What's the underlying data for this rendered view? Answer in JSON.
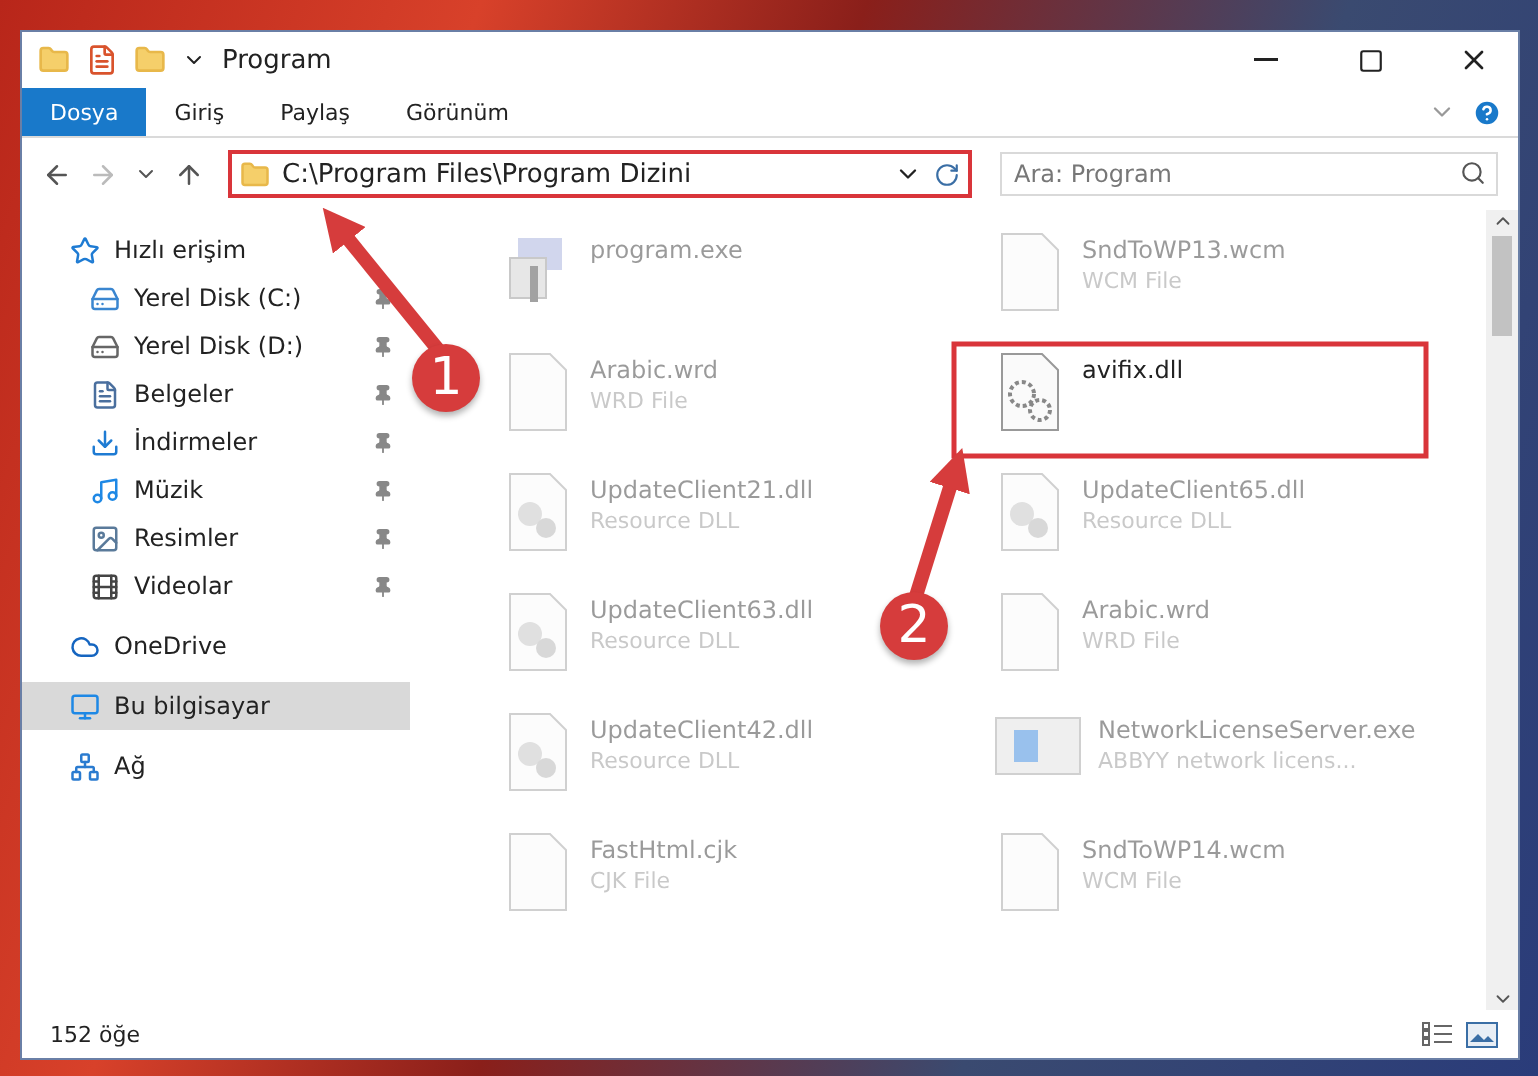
{
  "window": {
    "title": "Program"
  },
  "ribbon_tabs": [
    {
      "label": "Dosya",
      "selected": true
    },
    {
      "label": "Giriş",
      "selected": false
    },
    {
      "label": "Paylaş",
      "selected": false
    },
    {
      "label": "Görünüm",
      "selected": false
    }
  ],
  "address_bar": {
    "path": "C:\\Program Files\\Program Dizini",
    "highlighted": true
  },
  "search": {
    "placeholder": "Ara: Program"
  },
  "sidebar": {
    "items": [
      {
        "kind": "star",
        "label": "Hızlı erişim",
        "selected": false,
        "children": [
          {
            "kind": "drive-c",
            "label": "Yerel Disk (C:)",
            "pinned": true,
            "selected": false
          },
          {
            "kind": "drive",
            "label": "Yerel Disk (D:)",
            "pinned": true,
            "selected": false
          },
          {
            "kind": "docs",
            "label": "Belgeler",
            "pinned": true,
            "selected": false
          },
          {
            "kind": "download",
            "label": "İndirmeler",
            "pinned": true,
            "selected": false
          },
          {
            "kind": "music",
            "label": "Müzik",
            "pinned": true,
            "selected": false
          },
          {
            "kind": "pictures",
            "label": "Resimler",
            "pinned": true,
            "selected": false
          },
          {
            "kind": "video",
            "label": "Videolar",
            "pinned": true,
            "selected": false
          }
        ]
      },
      {
        "kind": "cloud",
        "label": "OneDrive",
        "selected": false
      },
      {
        "kind": "pc",
        "label": "Bu bilgisayar",
        "selected": true
      },
      {
        "kind": "network",
        "label": "Ağ",
        "selected": false
      }
    ]
  },
  "files": [
    {
      "kind": "app",
      "name": "program.exe",
      "dimmed": true,
      "highlighted": false
    },
    {
      "kind": "blank",
      "name": "SndToWP13.wcm",
      "type": "WCM File",
      "dimmed": true,
      "highlighted": false
    },
    {
      "kind": "blank",
      "name": "Arabic.wrd",
      "type": "WRD File",
      "dimmed": true,
      "highlighted": false
    },
    {
      "kind": "gear",
      "name": "avifix.dll",
      "dimmed": false,
      "highlighted": true
    },
    {
      "kind": "dll",
      "name": "UpdateClient21.dll",
      "type": "Resource DLL",
      "dimmed": true,
      "highlighted": false
    },
    {
      "kind": "dll",
      "name": "UpdateClient65.dll",
      "type": "Resource DLL",
      "dimmed": true,
      "highlighted": false
    },
    {
      "kind": "dll",
      "name": "UpdateClient63.dll",
      "type": "Resource DLL",
      "dimmed": true,
      "highlighted": false
    },
    {
      "kind": "blank",
      "name": "Arabic.wrd",
      "type": "WRD File",
      "dimmed": true,
      "highlighted": false
    },
    {
      "kind": "dll",
      "name": "UpdateClient42.dll",
      "type": "Resource DLL",
      "dimmed": true,
      "highlighted": false
    },
    {
      "kind": "window",
      "name": "NetworkLicenseServer.exe",
      "type": "ABBYY network licens...",
      "dimmed": true,
      "highlighted": false
    },
    {
      "kind": "blank",
      "name": "FastHtml.cjk",
      "type": "CJK File",
      "dimmed": true,
      "highlighted": false
    },
    {
      "kind": "blank",
      "name": "SndToWP14.wcm",
      "type": "WCM File",
      "dimmed": true,
      "highlighted": false
    }
  ],
  "status_bar": {
    "count": "152 öğe"
  },
  "annotations": [
    {
      "number": "1"
    },
    {
      "number": "2"
    }
  ]
}
